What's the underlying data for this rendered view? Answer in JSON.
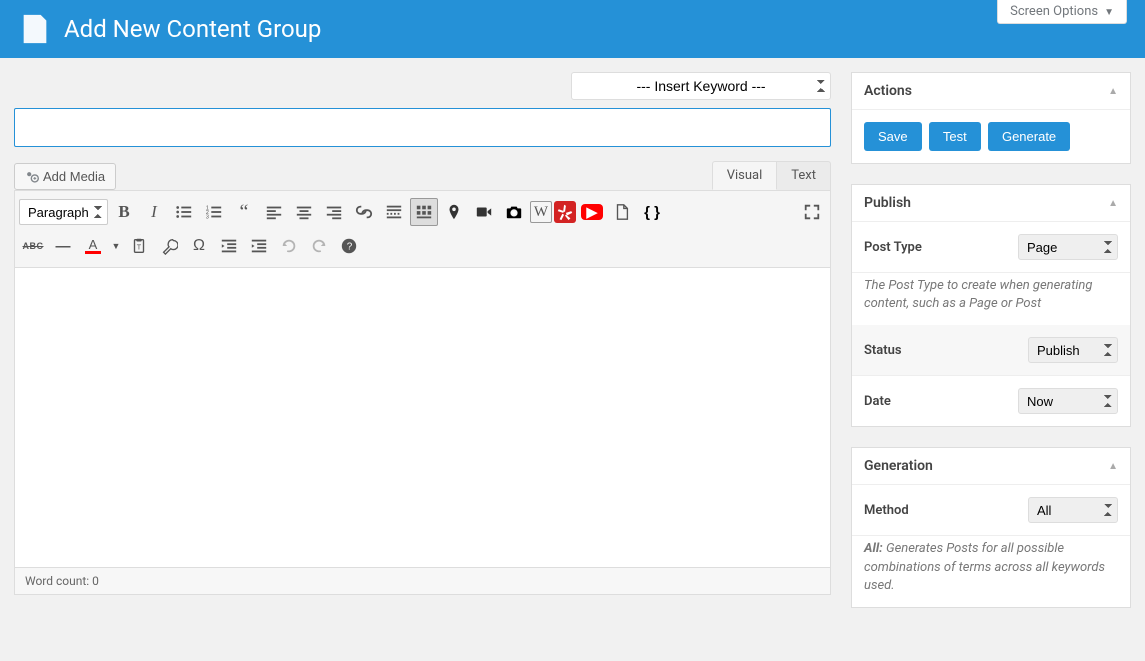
{
  "header": {
    "title": "Add New Content Group",
    "screen_options": "Screen Options"
  },
  "keyword": {
    "placeholder": "--- Insert Keyword ---"
  },
  "title_input": {
    "value": ""
  },
  "editor": {
    "add_media": "Add Media",
    "tab_visual": "Visual",
    "tab_text": "Text",
    "format_select": "Paragraph",
    "word_count_label": "Word count: 0"
  },
  "sidebar": {
    "actions": {
      "title": "Actions",
      "save": "Save",
      "test": "Test",
      "generate": "Generate"
    },
    "publish": {
      "title": "Publish",
      "post_type_label": "Post Type",
      "post_type_value": "Page",
      "post_type_help": "The Post Type to create when generating content, such as a Page or Post",
      "status_label": "Status",
      "status_value": "Publish",
      "date_label": "Date",
      "date_value": "Now"
    },
    "generation": {
      "title": "Generation",
      "method_label": "Method",
      "method_value": "All",
      "method_help_prefix": "All:",
      "method_help_text": " Generates Posts for all possible combinations of terms across all keywords used."
    }
  }
}
